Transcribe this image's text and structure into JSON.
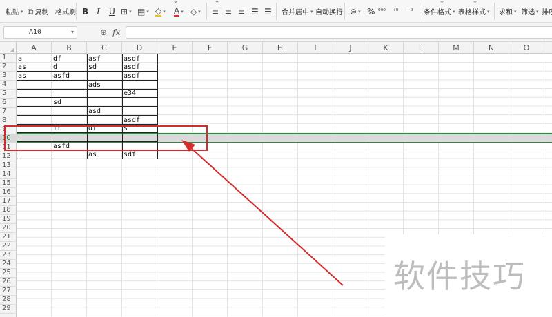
{
  "ribbon": {
    "paste": "粘贴",
    "copy": "复制",
    "format_painter": "格式刷",
    "bold": "B",
    "italic": "I",
    "underline": "U",
    "merge_center": "合并居中",
    "wrap_text": "自动换行",
    "percent": "%",
    "cond_format": "条件格式",
    "table_style": "表格样式",
    "sum": "求和",
    "filter": "筛选",
    "sort": "排序"
  },
  "formula_bar": {
    "cell_ref": "A10",
    "fx_label": "fx",
    "content": ""
  },
  "columns": [
    "A",
    "B",
    "C",
    "D",
    "E",
    "F",
    "G",
    "H",
    "I",
    "J",
    "K",
    "L",
    "M",
    "N",
    "O"
  ],
  "rows": [
    "1",
    "2",
    "3",
    "4",
    "5",
    "6",
    "7",
    "8",
    "9",
    "10",
    "11",
    "12",
    "13",
    "14",
    "15",
    "16",
    "17",
    "18",
    "19",
    "20",
    "21",
    "22",
    "23",
    "24",
    "25",
    "26",
    "27",
    "28",
    "29"
  ],
  "selected_row": "10",
  "sheet": {
    "r1": [
      "a",
      "df",
      "asf",
      "asdf"
    ],
    "r2": [
      "as",
      "d",
      "sd",
      "asdf"
    ],
    "r3": [
      "as",
      "asfd",
      "",
      "asdf"
    ],
    "r4": [
      "",
      "",
      "ads",
      ""
    ],
    "r5": [
      "",
      "",
      "",
      "e34"
    ],
    "r6": [
      "",
      "sd",
      "",
      ""
    ],
    "r7": [
      "",
      "",
      "asd",
      ""
    ],
    "r8": [
      "",
      "",
      "",
      "asdf"
    ],
    "r9": [
      "",
      "fr",
      "df",
      "s"
    ],
    "r10": [
      "",
      "",
      "",
      ""
    ],
    "r11": [
      "",
      "asfd",
      "",
      ""
    ],
    "r12": [
      "",
      "",
      "as",
      "sdf"
    ]
  },
  "watermark": "软件技巧",
  "colors": {
    "accent_green": "#2e8b46",
    "annotation_red": "#d42b2b"
  }
}
